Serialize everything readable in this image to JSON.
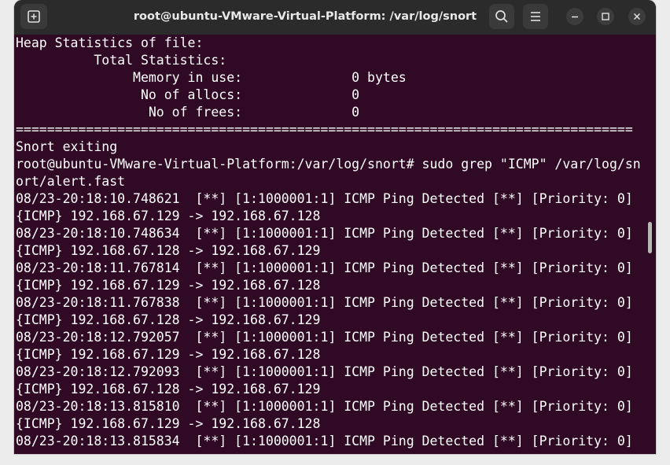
{
  "window": {
    "title": "root@ubuntu-VMware-Virtual-Platform: /var/log/snort",
    "icons": {
      "new_tab": "new-tab-icon",
      "search": "search-icon",
      "menu": "hamburger-menu-icon",
      "minimize": "minimize-icon",
      "maximize": "maximize-icon",
      "close": "close-icon"
    }
  },
  "colors": {
    "terminal_bg": "#300a24",
    "titlebar_bg": "#2b2b2b",
    "text": "#ffffff"
  },
  "terminal": {
    "lines": [
      "Heap Statistics of file:",
      "          Total Statistics:",
      "               Memory in use:              0 bytes",
      "                No of allocs:              0",
      "                 No of frees:              0",
      "===============================================================================",
      "Snort exiting",
      "root@ubuntu-VMware-Virtual-Platform:/var/log/snort# sudo grep \"ICMP\" /var/log/sn",
      "ort/alert.fast",
      "08/23-20:18:10.748621  [**] [1:1000001:1] ICMP Ping Detected [**] [Priority: 0]",
      "{ICMP} 192.168.67.129 -> 192.168.67.128",
      "08/23-20:18:10.748634  [**] [1:1000001:1] ICMP Ping Detected [**] [Priority: 0]",
      "{ICMP} 192.168.67.128 -> 192.168.67.129",
      "08/23-20:18:11.767814  [**] [1:1000001:1] ICMP Ping Detected [**] [Priority: 0]",
      "{ICMP} 192.168.67.129 -> 192.168.67.128",
      "08/23-20:18:11.767838  [**] [1:1000001:1] ICMP Ping Detected [**] [Priority: 0]",
      "{ICMP} 192.168.67.128 -> 192.168.67.129",
      "08/23-20:18:12.792057  [**] [1:1000001:1] ICMP Ping Detected [**] [Priority: 0]",
      "{ICMP} 192.168.67.129 -> 192.168.67.128",
      "08/23-20:18:12.792093  [**] [1:1000001:1] ICMP Ping Detected [**] [Priority: 0]",
      "{ICMP} 192.168.67.128 -> 192.168.67.129",
      "08/23-20:18:13.815810  [**] [1:1000001:1] ICMP Ping Detected [**] [Priority: 0]",
      "{ICMP} 192.168.67.129 -> 192.168.67.128",
      "08/23-20:18:13.815834  [**] [1:1000001:1] ICMP Ping Detected [**] [Priority: 0]"
    ]
  }
}
